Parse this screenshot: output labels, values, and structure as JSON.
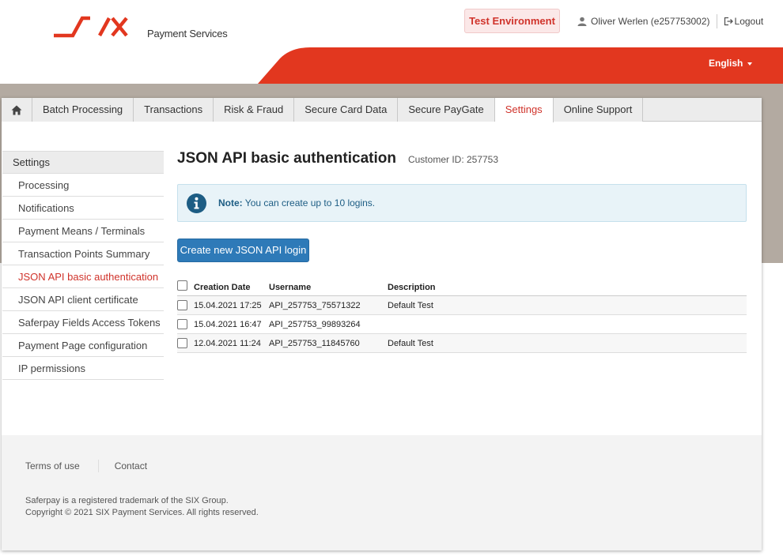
{
  "header": {
    "brand_sub": "Payment Services",
    "environment": "Test Environment",
    "user_name": "Oliver Werlen (e257753002)",
    "logout": "Logout",
    "language": "English"
  },
  "tabs": [
    {
      "label": "Batch Processing"
    },
    {
      "label": "Transactions"
    },
    {
      "label": "Risk & Fraud"
    },
    {
      "label": "Secure Card Data"
    },
    {
      "label": "Secure PayGate"
    },
    {
      "label": "Settings"
    },
    {
      "label": "Online Support"
    }
  ],
  "sidebar": {
    "heading": "Settings",
    "items": [
      {
        "label": "Processing"
      },
      {
        "label": "Notifications"
      },
      {
        "label": "Payment Means / Terminals"
      },
      {
        "label": "Transaction Points Summary"
      },
      {
        "label": "JSON API basic authentication"
      },
      {
        "label": "JSON API client certificate"
      },
      {
        "label": "Saferpay Fields Access Tokens"
      },
      {
        "label": "Payment Page configuration"
      },
      {
        "label": "IP permissions"
      }
    ]
  },
  "main": {
    "title": "JSON API basic authentication",
    "customer_id": "Customer ID: 257753",
    "note_label": "Note:",
    "note_text": " You can create up to 10 logins.",
    "create_button": "Create new JSON API login",
    "table": {
      "headers": [
        "Creation Date",
        "Username",
        "Description"
      ],
      "rows": [
        {
          "date": "15.04.2021 17:25",
          "username": "API_257753_75571322",
          "description": "Default Test"
        },
        {
          "date": "15.04.2021 16:47",
          "username": "API_257753_99893264",
          "description": ""
        },
        {
          "date": "12.04.2021 11:24",
          "username": "API_257753_11845760",
          "description": "Default Test"
        }
      ]
    }
  },
  "footer": {
    "terms": "Terms of use",
    "contact": "Contact",
    "trademark": "Saferpay is a registered trademark of the SIX Group.",
    "copyright": "Copyright © 2021 SIX Payment Services. All rights reserved."
  },
  "colors": {
    "brand_red": "#e2371f",
    "active_red": "#d0332b",
    "button_blue": "#2e7ab8",
    "taupe": "#b3aaa1"
  },
  "icons": [
    "six-logo",
    "user-icon",
    "logout-icon",
    "home-icon",
    "info-icon",
    "caret-down-icon"
  ]
}
